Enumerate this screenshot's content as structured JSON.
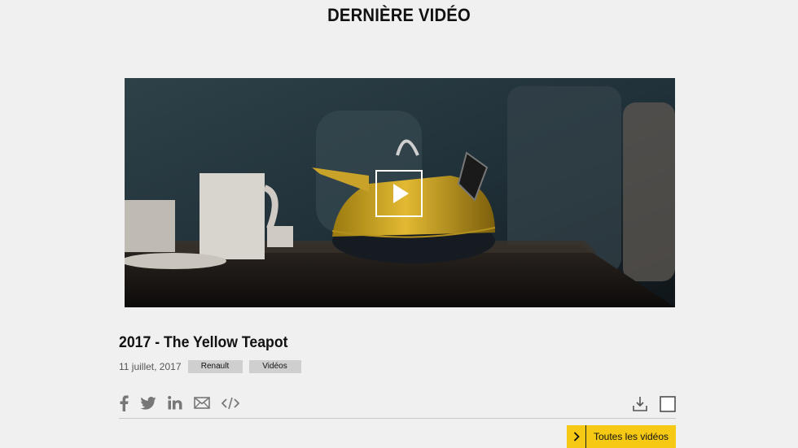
{
  "section": {
    "title": "DERNIÈRE VIDÉO"
  },
  "video": {
    "title": "2017 - The Yellow Teapot",
    "date": "11 juillet, 2017",
    "tags": [
      "Renault",
      "Vidéos"
    ]
  },
  "share": {
    "icons": [
      "facebook-icon",
      "twitter-icon",
      "linkedin-icon",
      "email-icon",
      "embed-code-icon"
    ]
  },
  "tools": {
    "icons": [
      "download-icon",
      "checkbox-icon"
    ]
  },
  "cta": {
    "label": "Toutes les vidéos"
  },
  "colors": {
    "accent": "#f6c915",
    "background": "#f0f0f0",
    "tag_bg": "#cfcfcf"
  }
}
